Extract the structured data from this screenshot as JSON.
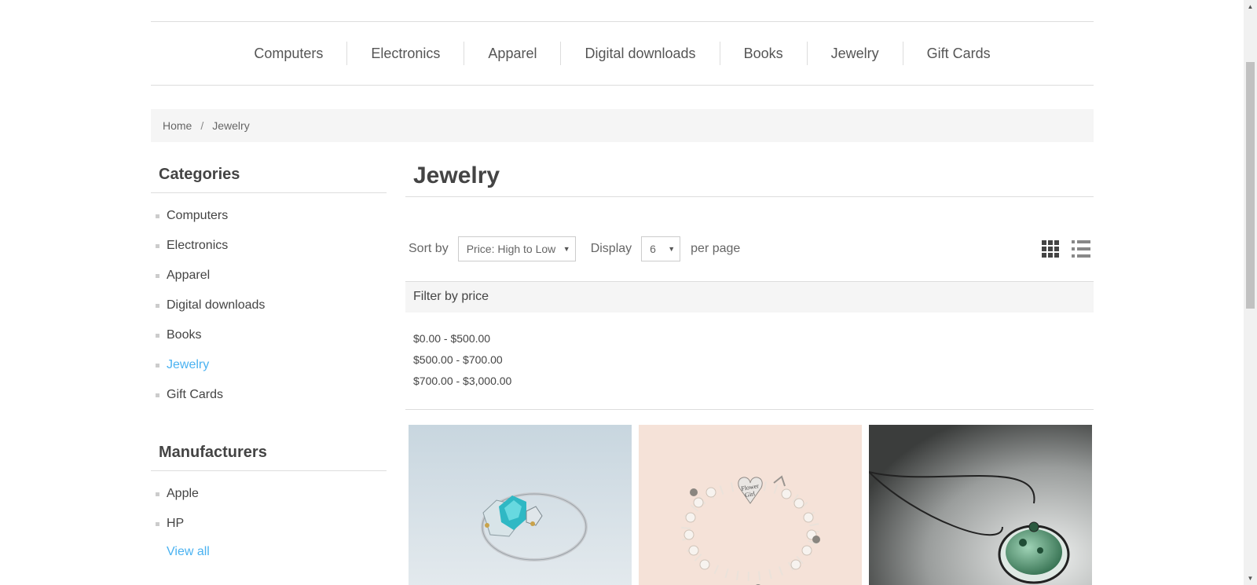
{
  "top_nav": [
    "Computers",
    "Electronics",
    "Apparel",
    "Digital downloads",
    "Books",
    "Jewelry",
    "Gift Cards"
  ],
  "breadcrumb": {
    "home": "Home",
    "separator": "/",
    "current": "Jewelry"
  },
  "categories": {
    "title": "Categories",
    "items": [
      "Computers",
      "Electronics",
      "Apparel",
      "Digital downloads",
      "Books",
      "Jewelry",
      "Gift Cards"
    ],
    "active": "Jewelry"
  },
  "manufacturers": {
    "title": "Manufacturers",
    "items": [
      "Apple",
      "HP"
    ],
    "view_all": "View all"
  },
  "main": {
    "title": "Jewelry",
    "sort_label": "Sort by",
    "sort_value": "Price: High to Low",
    "display_label": "Display",
    "display_value": "6",
    "per_page": "per page"
  },
  "filter": {
    "title": "Filter by price",
    "ranges": [
      "$0.00 - $500.00",
      "$500.00 - $700.00",
      "$700.00 - $3,000.00"
    ]
  },
  "products": [
    {
      "image": "ring-with-blue-stone"
    },
    {
      "image": "pearl-bracelet-flower-girl-charm"
    },
    {
      "image": "green-glass-pendant-necklace"
    }
  ],
  "colors": {
    "accent": "#4ab2f1",
    "text": "#444444",
    "panel": "#f5f5f5",
    "border": "#dddddd"
  },
  "icons": [
    "grid-view-icon",
    "list-view-icon",
    "dropdown-arrow-icon",
    "scroll-up-arrow-icon",
    "scroll-down-arrow-icon"
  ]
}
